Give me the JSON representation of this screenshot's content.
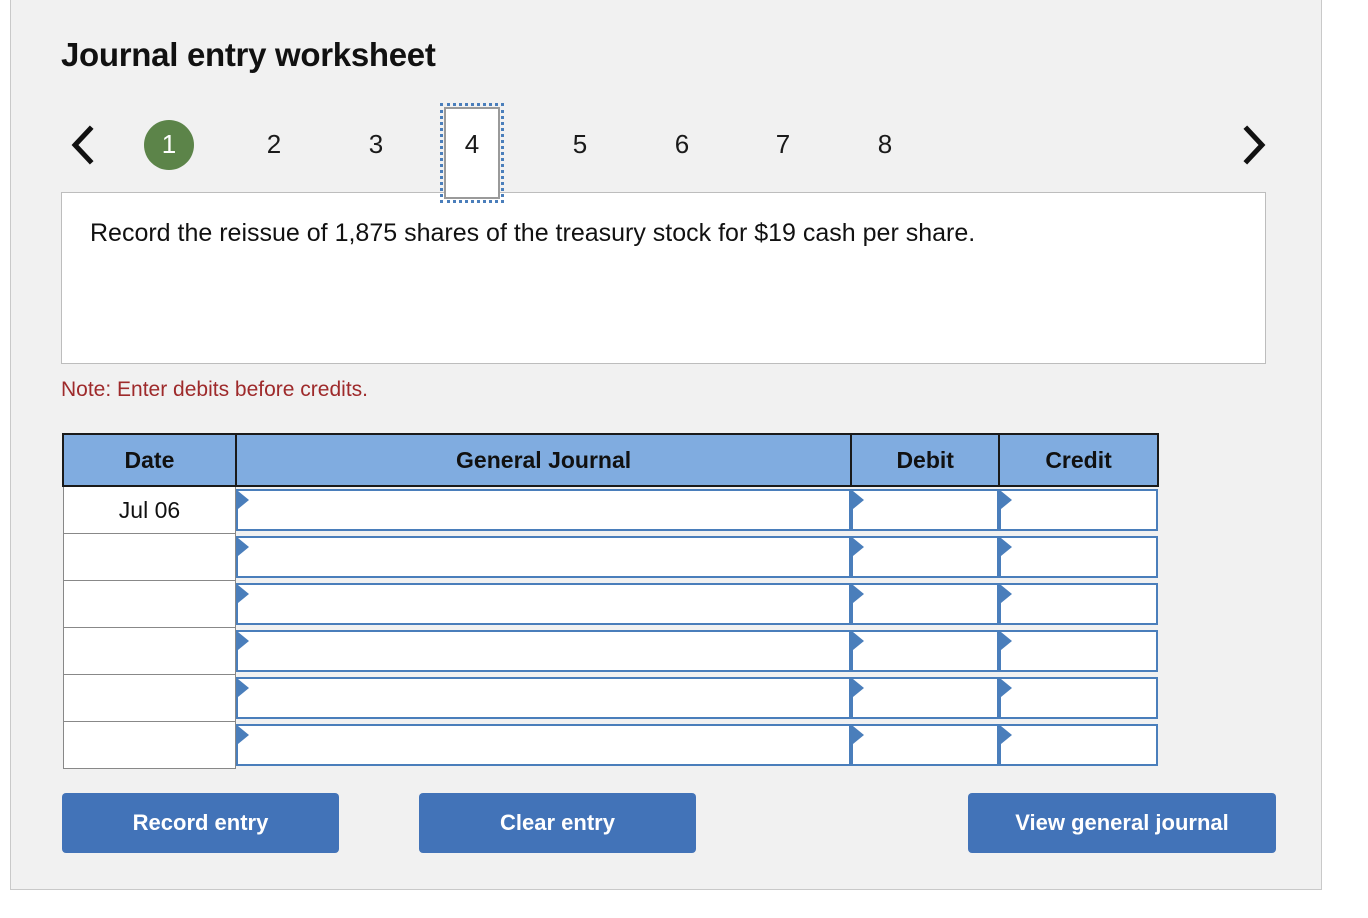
{
  "title": "Journal entry worksheet",
  "pager": {
    "prev_icon": "chevron-left-icon",
    "next_icon": "chevron-right-icon",
    "steps": [
      {
        "label": "1",
        "state": "done"
      },
      {
        "label": "2",
        "state": "normal"
      },
      {
        "label": "3",
        "state": "normal"
      },
      {
        "label": "4",
        "state": "current"
      },
      {
        "label": "5",
        "state": "normal"
      },
      {
        "label": "6",
        "state": "normal"
      },
      {
        "label": "7",
        "state": "normal"
      },
      {
        "label": "8",
        "state": "normal"
      }
    ]
  },
  "question": {
    "text": "Record the reissue of 1,875 shares of the treasury stock for $19 cash per share."
  },
  "note": "Note: Enter debits before credits.",
  "table": {
    "columns": [
      "Date",
      "General Journal",
      "Debit",
      "Credit"
    ],
    "rows": [
      {
        "date": "Jul 06",
        "general_journal": "",
        "debit": "",
        "credit": ""
      },
      {
        "date": "",
        "general_journal": "",
        "debit": "",
        "credit": ""
      },
      {
        "date": "",
        "general_journal": "",
        "debit": "",
        "credit": ""
      },
      {
        "date": "",
        "general_journal": "",
        "debit": "",
        "credit": ""
      },
      {
        "date": "",
        "general_journal": "",
        "debit": "",
        "credit": ""
      },
      {
        "date": "",
        "general_journal": "",
        "debit": "",
        "credit": ""
      }
    ]
  },
  "buttons": {
    "record_entry": "Record entry",
    "clear_entry": "Clear entry",
    "view_general_journal": "View general journal"
  },
  "colors": {
    "page_background": "#f1f1f1",
    "table_header_blue": "#80ace0",
    "button_blue": "#4273b8",
    "completed_step_green": "#5c8449",
    "note_red": "#9e2a2b",
    "field_border_blue": "#4a7ebb"
  }
}
